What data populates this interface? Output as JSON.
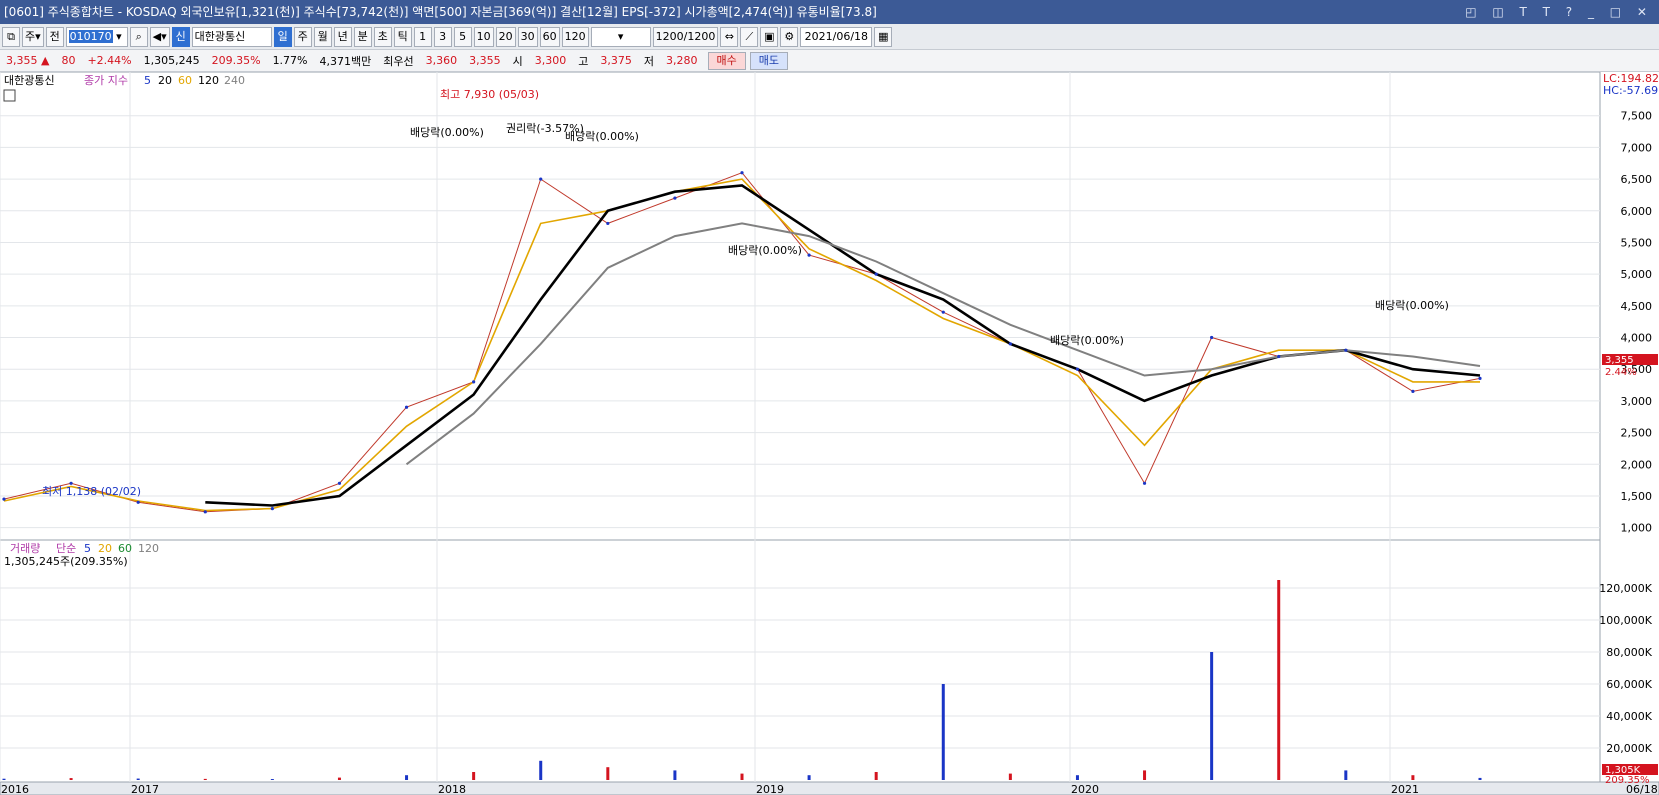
{
  "window": {
    "title": "[0601] 주식종합차트 - KOSDAQ 외국인보유[1,321(천)] 주식수[73,742(천)] 액면[500] 자본금[369(억)] 결산[12월] EPS[-372] 시가총액[2,474(억)] 유통비율[73.8]",
    "icons": [
      "restore-icon",
      "tile-icon",
      "font-icon",
      "text-icon",
      "help-icon",
      "minimize-icon",
      "maximize-icon",
      "close-icon"
    ],
    "icon_glyphs": "◰ ◫ T T ? _ □ ✕"
  },
  "toolbar": {
    "market_label": "주",
    "prev_label": "전",
    "stock_code": "010170",
    "search_glyph": "🔍",
    "new_label": "신",
    "stock_name": "대한광통신",
    "periods": [
      "일",
      "주",
      "월",
      "년",
      "분",
      "초",
      "틱"
    ],
    "selected_period": "일",
    "intervals": [
      "1",
      "3",
      "5",
      "10",
      "20",
      "30",
      "60",
      "120"
    ],
    "count": "1200/1200",
    "date": "2021/06/18"
  },
  "quote": {
    "price": "3,355 ▲",
    "change": "80",
    "change_pct": "+2.44%",
    "volume": "1,305,245",
    "volume_ratio": "209.35%",
    "turnover": "1.77%",
    "amount": "4,371백만",
    "best_bid_label": "최우선",
    "best_ask": "3,360",
    "best_bid": "3,355",
    "open_label": "시",
    "open": "3,300",
    "high_label": "고",
    "high": "3,375",
    "low_label": "저",
    "low": "3,280",
    "buy_label": "매수",
    "sell_label": "매도"
  },
  "price_pane": {
    "legend_name": "대한광통신",
    "legend_ma_label": "종가 지수",
    "legend_periods": [
      "5",
      "20",
      "60",
      "120",
      "240"
    ],
    "lc_label": "LC:194.82",
    "hc_label": "HC:-57.69",
    "current_price_label": "3,355",
    "current_pct_label": "2.44%",
    "y_ticks": [
      "7,500",
      "7,000",
      "6,500",
      "6,000",
      "5,500",
      "5,000",
      "4,500",
      "4,000",
      "3,500",
      "3,000",
      "2,500",
      "2,000",
      "1,500",
      "1,000"
    ],
    "high_annotation": "최고 7,930 (05/03)",
    "low_annotation": "최저 1,138 (02/02)",
    "events": [
      "배당락(0.00%)",
      "권리락(-3.57%)",
      "배당락(0.00%)",
      "배당락(0.00%)",
      "배당락(0.00%)",
      "배당락(0.00%)"
    ]
  },
  "volume_pane": {
    "legend_label": "거래량",
    "legend_ma_label": "단순",
    "legend_periods": [
      "5",
      "20",
      "60",
      "120"
    ],
    "current_label": "1,305,245주(209.35%)",
    "current_value_tag": "1,305K",
    "current_pct_tag": "209.35%",
    "y_ticks": [
      "120,000K",
      "100,000K",
      "80,000K",
      "60,000K",
      "40,000K",
      "20,000K"
    ]
  },
  "x_axis": {
    "labels": [
      "2016",
      "2017",
      "2018",
      "2019",
      "2020",
      "2021",
      "06/18"
    ]
  },
  "colors": {
    "title_bg": "#3c5a96",
    "up": "#d4141f",
    "down": "#1a35c6",
    "ma5": "#1a35c6",
    "ma20": "#e2a600",
    "ma60": "#000000",
    "ma120": "#808080"
  },
  "chart_data": {
    "type": "line",
    "x": [
      "2016-01",
      "2016-04",
      "2016-07",
      "2016-10",
      "2017-01",
      "2017-04",
      "2017-07",
      "2017-10",
      "2018-01",
      "2018-04",
      "2018-07",
      "2018-10",
      "2019-01",
      "2019-04",
      "2019-07",
      "2019-10",
      "2020-01",
      "2020-03",
      "2020-07",
      "2020-10",
      "2021-01",
      "2021-04",
      "2021-06"
    ],
    "series": [
      {
        "name": "종가",
        "values": [
          1450,
          1700,
          1400,
          1250,
          1300,
          1700,
          2900,
          3300,
          6500,
          5800,
          6200,
          6600,
          5300,
          5000,
          4400,
          3900,
          3500,
          1700,
          4000,
          3700,
          3800,
          3150,
          3355
        ]
      },
      {
        "name": "20",
        "values": [
          1420,
          1650,
          1420,
          1270,
          1300,
          1600,
          2600,
          3300,
          5800,
          6000,
          6300,
          6500,
          5400,
          4900,
          4300,
          3900,
          3400,
          2300,
          3500,
          3800,
          3800,
          3300,
          3300
        ]
      },
      {
        "name": "60",
        "values": [
          null,
          null,
          null,
          1400,
          1350,
          1500,
          2300,
          3100,
          4600,
          6000,
          6300,
          6400,
          5700,
          5000,
          4600,
          3900,
          3500,
          3000,
          3400,
          3700,
          3800,
          3500,
          3400
        ]
      },
      {
        "name": "120",
        "values": [
          null,
          null,
          null,
          null,
          null,
          null,
          2000,
          2800,
          3900,
          5100,
          5600,
          5800,
          5600,
          5200,
          4700,
          4200,
          3800,
          3400,
          3500,
          3700,
          3800,
          3700,
          3550
        ]
      }
    ],
    "ylim": [
      900,
      8000
    ],
    "volume_values_k": [
      800,
      1200,
      900,
      700,
      600,
      1500,
      3000,
      5000,
      12000,
      8000,
      6000,
      4000,
      3000,
      5000,
      60000,
      4000,
      3000,
      6000,
      80000,
      125000,
      6000,
      3000,
      1305
    ]
  }
}
